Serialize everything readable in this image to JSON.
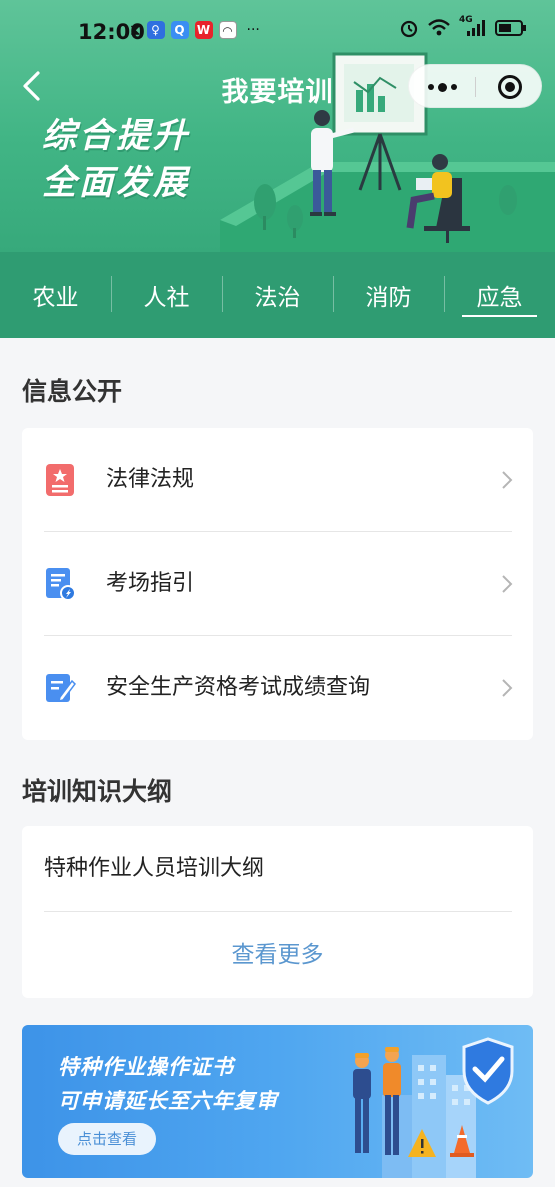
{
  "status_bar": {
    "time": "12:00",
    "left_icons": [
      "hourglass-icon",
      "bulb-app-icon",
      "search-app-icon",
      "weibo-app-icon",
      "chat-app-icon"
    ],
    "more": "···",
    "right_icons": [
      "alarm-icon",
      "wifi-icon",
      "signal-4g-icon",
      "battery-icon"
    ],
    "network_label": "4G"
  },
  "header": {
    "title": "我要培训",
    "slogan_line1": "综合提升",
    "slogan_line2": "全面发展",
    "accent_color": "#41b585"
  },
  "tabs": [
    {
      "label": "农业",
      "active": false
    },
    {
      "label": "人社",
      "active": false
    },
    {
      "label": "法治",
      "active": false
    },
    {
      "label": "消防",
      "active": false
    },
    {
      "label": "应急",
      "active": true
    }
  ],
  "info_section": {
    "title": "信息公开",
    "items": [
      {
        "label": "法律法规",
        "icon": "law-document-icon"
      },
      {
        "label": "考场指引",
        "icon": "exam-guide-icon"
      },
      {
        "label": "安全生产资格考试成绩查询",
        "icon": "score-query-icon"
      }
    ]
  },
  "outline_section": {
    "title": "培训知识大纲",
    "items": [
      {
        "label": "特种作业人员培训大纲"
      }
    ],
    "more_label": "查看更多"
  },
  "banner": {
    "line1": "特种作业操作证书",
    "line2": "可申请延长至六年复审",
    "button_label": "点击查看"
  }
}
